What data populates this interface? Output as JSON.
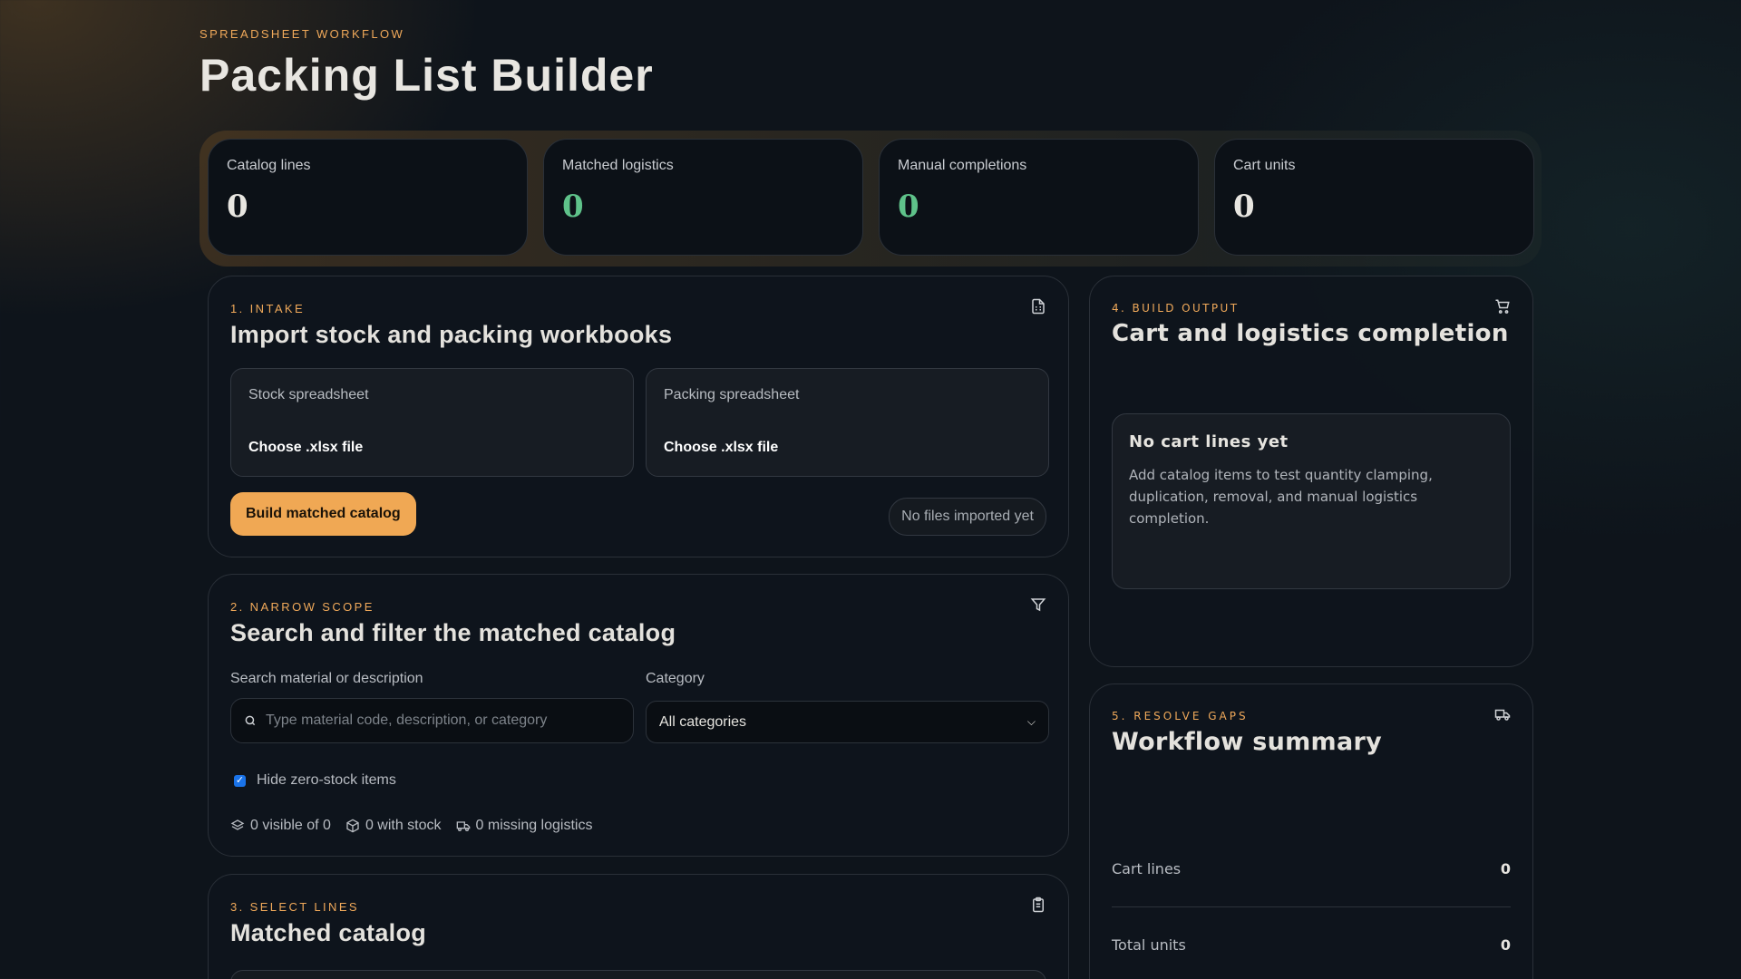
{
  "header": {
    "eyebrow": "Spreadsheet workflow",
    "title": "Packing List Builder"
  },
  "stats": [
    {
      "label": "Catalog lines",
      "value": "0"
    },
    {
      "label": "Matched logistics",
      "value": "0"
    },
    {
      "label": "Manual completions",
      "value": "0"
    },
    {
      "label": "Cart units",
      "value": "0"
    }
  ],
  "intake": {
    "eyebrow": "1. Intake",
    "title": "Import stock and packing workbooks",
    "stock": {
      "label": "Stock spreadsheet",
      "button": "Choose .xlsx file"
    },
    "packing": {
      "label": "Packing spreadsheet",
      "button": "Choose .xlsx file"
    },
    "build_button": "Build matched catalog",
    "status": "No files imported yet"
  },
  "scope": {
    "eyebrow": "2. Narrow scope",
    "title": "Search and filter the matched catalog",
    "search_label": "Search material or description",
    "search_placeholder": "Type material code, description, or category",
    "search_value": "",
    "category_label": "Category",
    "category_value": "All categories",
    "hide_zero_label": "Hide zero-stock items",
    "hide_zero_checked": true,
    "visible": "0 visible of 0",
    "with_stock": "0 with stock",
    "missing": "0 missing logistics"
  },
  "select": {
    "eyebrow": "3. Select lines",
    "title": "Matched catalog"
  },
  "output": {
    "eyebrow": "4. Build output",
    "title": "Cart and logistics completion",
    "empty_title": "No cart lines yet",
    "empty_text": "Add catalog items to test quantity clamping, duplication, removal, and manual logistics completion."
  },
  "summary": {
    "eyebrow": "5. Resolve gaps",
    "title": "Workflow summary",
    "rows": [
      {
        "label": "Cart lines",
        "value": "0"
      },
      {
        "label": "Total units",
        "value": "0"
      }
    ]
  },
  "colors": {
    "accent": "#f0a854",
    "green": "#5fc28a",
    "bg": "#0e141b"
  }
}
